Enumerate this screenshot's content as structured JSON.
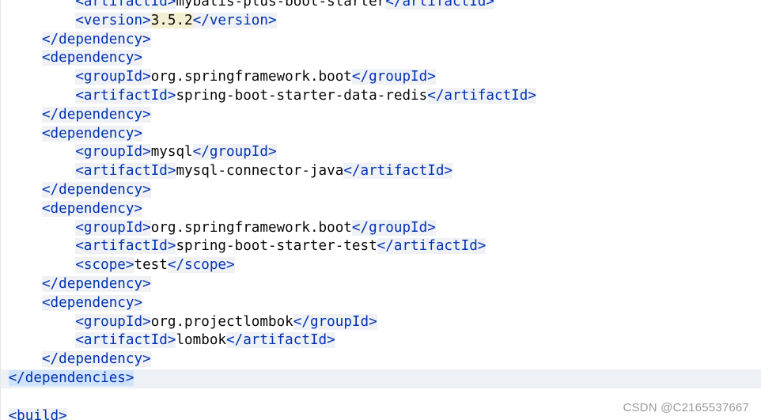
{
  "editor": {
    "lines": [
      {
        "indent": 8,
        "tag": "artifactId",
        "value": "mybatis-plus-boot-starter",
        "kind": "pair"
      },
      {
        "indent": 8,
        "tag": "version",
        "value": "3.5.2",
        "kind": "pair",
        "highlight_value": true
      },
      {
        "indent": 4,
        "tag": "dependency",
        "kind": "close"
      },
      {
        "indent": 4,
        "tag": "dependency",
        "kind": "open"
      },
      {
        "indent": 8,
        "tag": "groupId",
        "value": "org.springframework.boot",
        "kind": "pair"
      },
      {
        "indent": 8,
        "tag": "artifactId",
        "value": "spring-boot-starter-data-redis",
        "kind": "pair"
      },
      {
        "indent": 4,
        "tag": "dependency",
        "kind": "close"
      },
      {
        "indent": 4,
        "tag": "dependency",
        "kind": "open"
      },
      {
        "indent": 8,
        "tag": "groupId",
        "value": "mysql",
        "kind": "pair"
      },
      {
        "indent": 8,
        "tag": "artifactId",
        "value": "mysql-connector-java",
        "kind": "pair"
      },
      {
        "indent": 4,
        "tag": "dependency",
        "kind": "close"
      },
      {
        "indent": 4,
        "tag": "dependency",
        "kind": "open"
      },
      {
        "indent": 8,
        "tag": "groupId",
        "value": "org.springframework.boot",
        "kind": "pair"
      },
      {
        "indent": 8,
        "tag": "artifactId",
        "value": "spring-boot-starter-test",
        "kind": "pair"
      },
      {
        "indent": 8,
        "tag": "scope",
        "value": "test",
        "kind": "pair"
      },
      {
        "indent": 4,
        "tag": "dependency",
        "kind": "close"
      },
      {
        "indent": 4,
        "tag": "dependency",
        "kind": "open"
      },
      {
        "indent": 8,
        "tag": "groupId",
        "value": "org.projectlombok",
        "kind": "pair"
      },
      {
        "indent": 8,
        "tag": "artifactId",
        "value": "lombok",
        "kind": "pair"
      },
      {
        "indent": 4,
        "tag": "dependency",
        "kind": "close"
      },
      {
        "indent": 0,
        "tag": "dependencies",
        "kind": "close",
        "current": true
      },
      {
        "indent": 0,
        "kind": "blank"
      },
      {
        "indent": 0,
        "tag": "build",
        "kind": "open"
      }
    ]
  },
  "watermark": "CSDN @C2165537667",
  "colors": {
    "tag": "#0033b3",
    "text": "#080808",
    "current_line": "#edf0f4",
    "tag_background": "#eff1f4",
    "selected_tag_background": "#cfe3fb",
    "version_highlight": "#f5efd1"
  }
}
